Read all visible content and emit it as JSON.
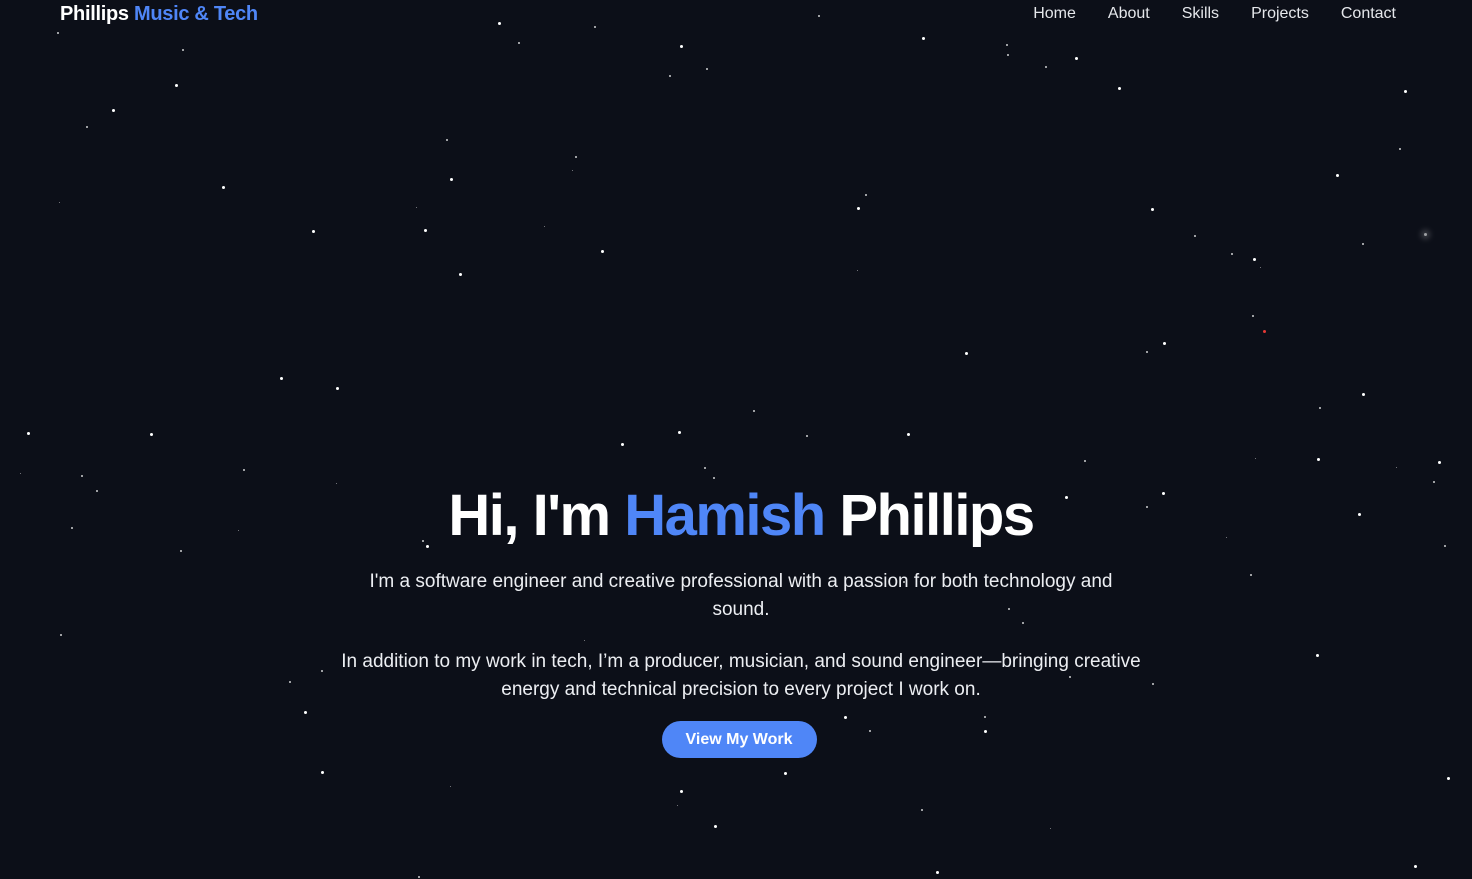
{
  "brand": {
    "name_main": "Phillips",
    "name_accent": "Music & Tech"
  },
  "nav": {
    "items": [
      {
        "label": "Home"
      },
      {
        "label": "About"
      },
      {
        "label": "Skills"
      },
      {
        "label": "Projects"
      },
      {
        "label": "Contact"
      }
    ]
  },
  "hero": {
    "greeting": "Hi, I'm",
    "first_name": "Hamish",
    "last_name": "Phillips",
    "intro": "I'm a software engineer and creative professional with a passion for both technology and sound.",
    "detail": "In addition to my work in tech, I’m a producer, musician, and sound engineer—bringing creative energy and technical precision to every project I work on.",
    "cta_label": "View My Work"
  },
  "colors": {
    "background": "#0c0f18",
    "accent": "#4f86f7",
    "text": "#ffffff"
  }
}
